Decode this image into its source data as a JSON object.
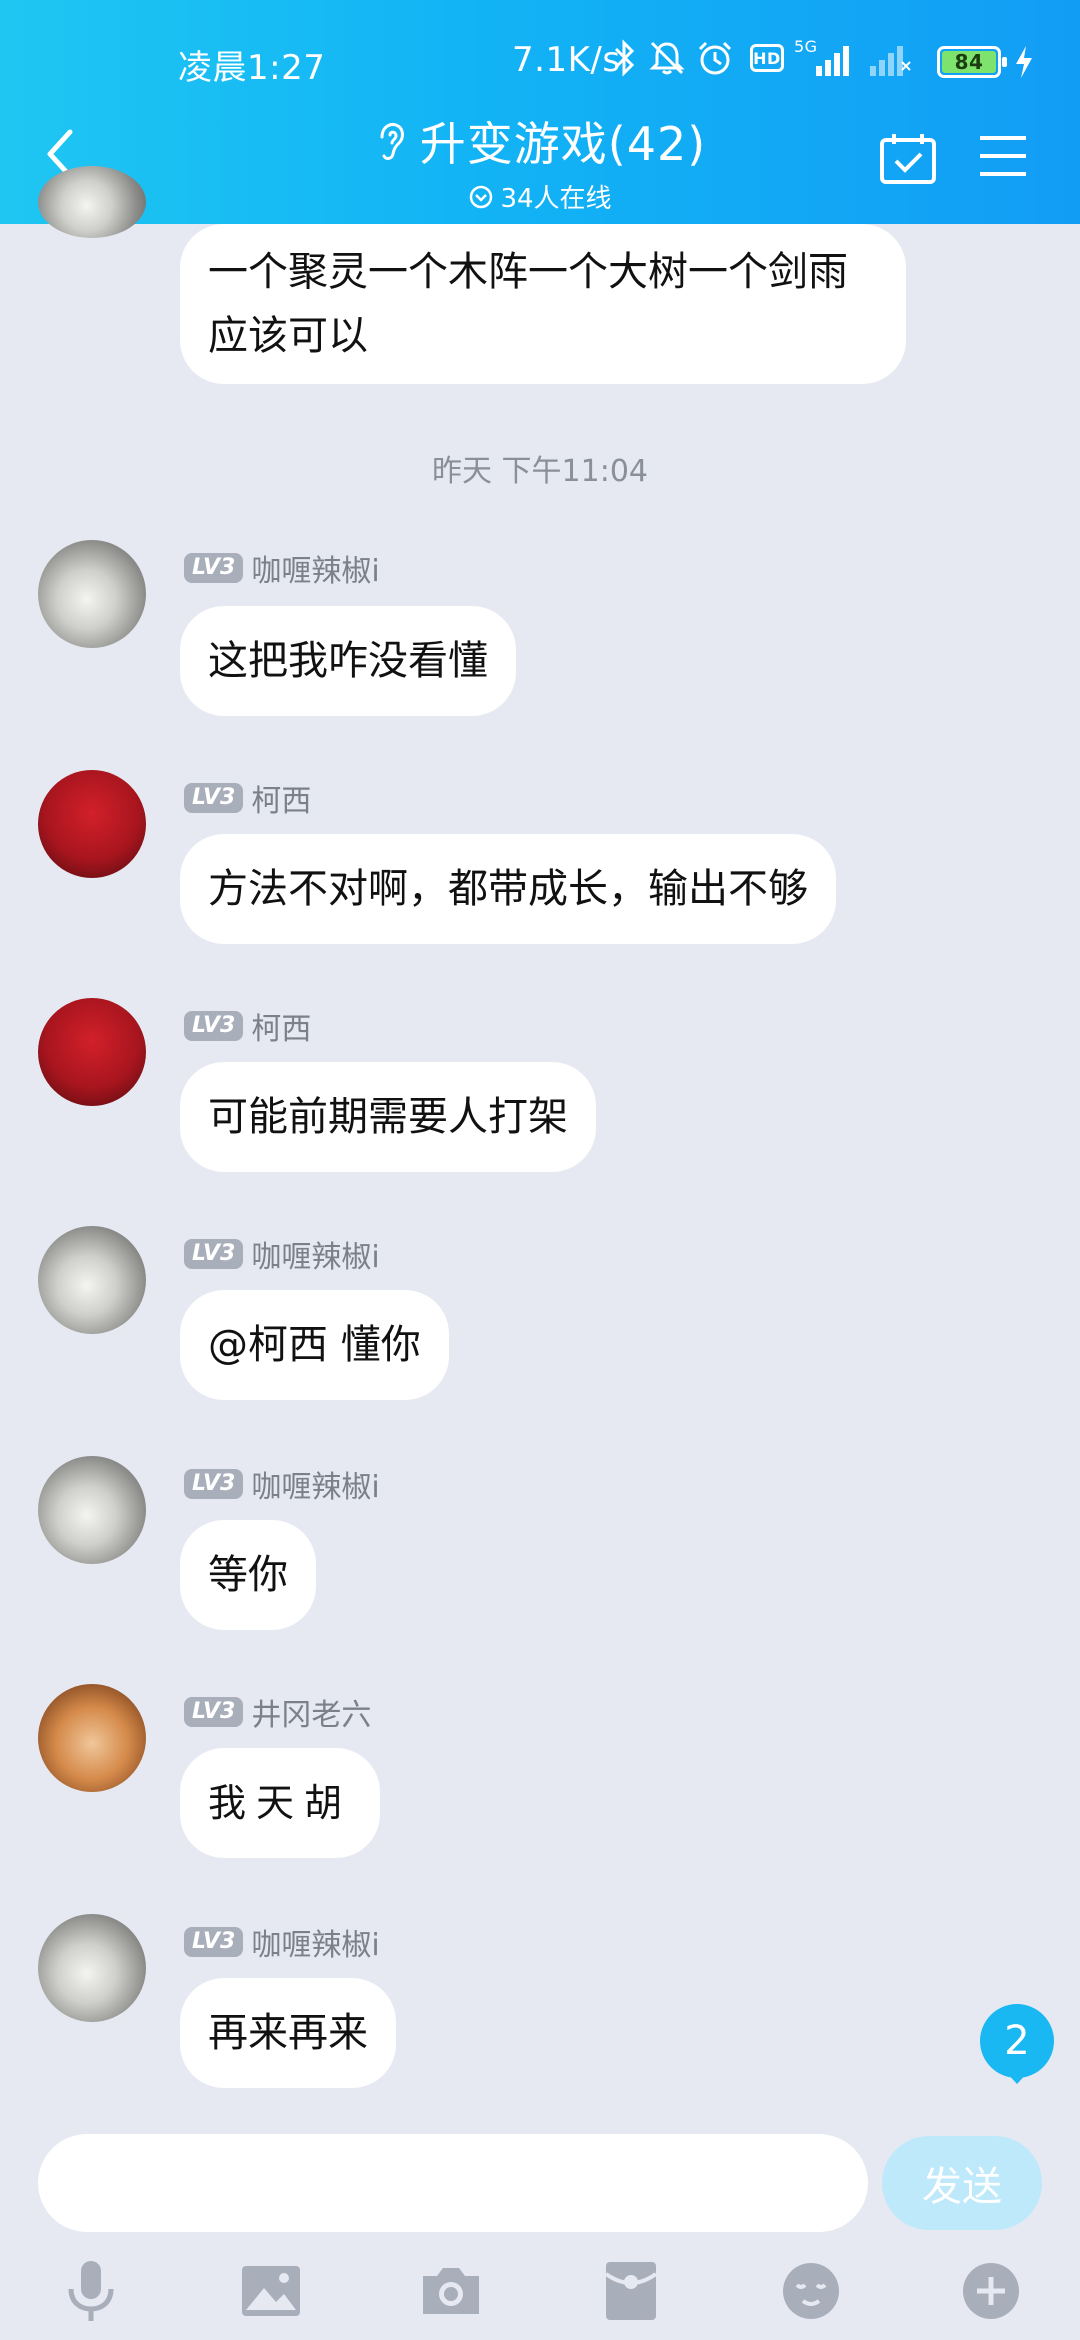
{
  "status_bar": {
    "time": "凌晨1:27",
    "network_speed": "7.1K/s",
    "network_type": "5G",
    "battery_level": "84",
    "icons": [
      "bluetooth-icon",
      "mute-icon",
      "alarm-icon",
      "hd-icon",
      "signal-icon",
      "signal-weak-icon",
      "battery-icon",
      "charging-icon"
    ]
  },
  "header": {
    "title": "升变游戏(42)",
    "online": "34人在线",
    "icons": [
      "back-icon",
      "ear-icon",
      "calendar-check-icon",
      "menu-icon"
    ]
  },
  "messages": [
    {
      "type": "text",
      "sender": "",
      "level": "",
      "text": "一个聚灵一个木阵一个大树一个剑雨 应该可以"
    },
    {
      "type": "timestamp",
      "text": "昨天 下午11:04"
    },
    {
      "sender": "咖喱辣椒i",
      "level": "LV3",
      "text": "这把我咋没看懂"
    },
    {
      "sender": "柯西",
      "level": "LV3",
      "text": "方法不对啊，都带成长，输出不够"
    },
    {
      "sender": "柯西",
      "level": "LV3",
      "text": "可能前期需要人打架"
    },
    {
      "sender": "咖喱辣椒i",
      "level": "LV3",
      "text": "@柯西 懂你"
    },
    {
      "sender": "咖喱辣椒i",
      "level": "LV3",
      "text": "等你"
    },
    {
      "sender": "井冈老六",
      "level": "LV3",
      "text": "我天胡"
    },
    {
      "sender": "咖喱辣椒i",
      "level": "LV3",
      "text": "再来再来"
    }
  ],
  "unread_count": "2",
  "input": {
    "value": "",
    "placeholder": "",
    "send_label": "发送"
  },
  "toolbar": [
    "microphone-icon",
    "image-icon",
    "camera-icon",
    "red-packet-icon",
    "emoji-icon",
    "plus-icon"
  ],
  "colors": {
    "header_start": "#1fc6f2",
    "header_end": "#129df5",
    "background": "#e6e9f1",
    "accent": "#19b8f2"
  }
}
